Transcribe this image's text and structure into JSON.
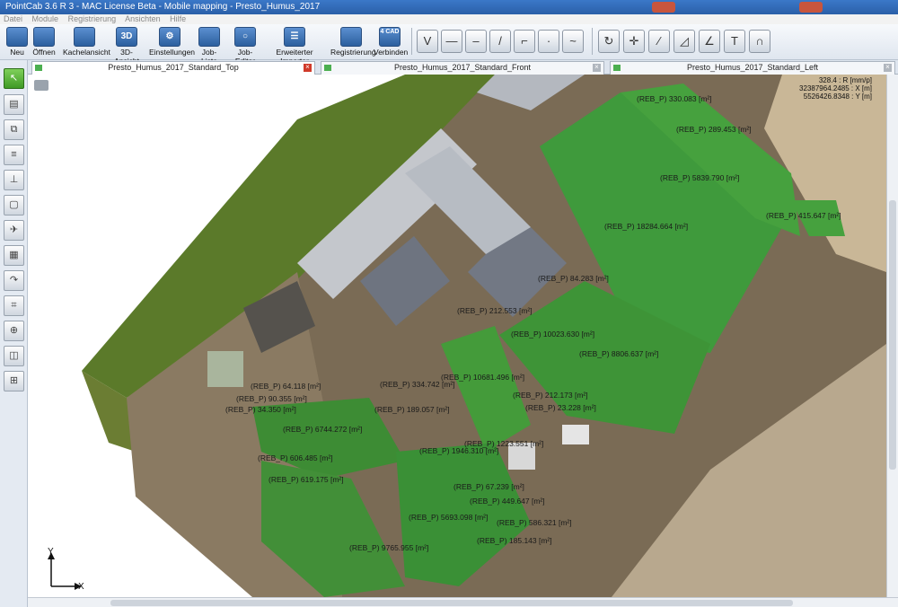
{
  "window": {
    "title": "PointCab 3.6 R 3 - MAC License Beta - Mobile mapping - Presto_Humus_2017"
  },
  "menu": [
    "Datei",
    "Module",
    "Registrierung",
    "Ansichten",
    "Hilfe"
  ],
  "toolbar": {
    "buttons": [
      {
        "label": "Neu",
        "icon": "new-icon"
      },
      {
        "label": "Öffnen",
        "icon": "open-folder-icon"
      },
      {
        "label": "Kachelansicht",
        "icon": "tile-view-icon"
      },
      {
        "label": "3D-Ansicht",
        "icon": "3d-view-icon",
        "glyph": "3D"
      },
      {
        "label": "Einstellungen",
        "icon": "settings-gear-icon"
      },
      {
        "label": "Job-Liste",
        "icon": "job-list-icon"
      },
      {
        "label": "Job-Editor",
        "icon": "job-editor-icon"
      },
      {
        "label": "Erweiterter Importer",
        "icon": "importer-icon"
      },
      {
        "label": "Registrierung",
        "icon": "registration-icon"
      },
      {
        "label": "Verbinden",
        "icon": "connect-cad-icon",
        "glyph": "4 CAD"
      }
    ]
  },
  "tabs": [
    {
      "label": "Presto_Humus_2017_Standard_Top",
      "active": true
    },
    {
      "label": "Presto_Humus_2017_Standard_Front",
      "active": false
    },
    {
      "label": "Presto_Humus_2017_Standard_Left",
      "active": false
    }
  ],
  "coords": {
    "resolution": "328.4 : R [mm/p]",
    "x": "32387964.2485 : X [m]",
    "y": "5526426.8348 : Y [m]"
  },
  "axes": {
    "y": "Y",
    "x": "X"
  },
  "areas": [
    "(REB_P) 330.083 [m²]",
    "(REB_P) 289.453 [m²]",
    "(REB_P) 5839.790 [m²]",
    "(REB_P) 415.647 [m²]",
    "(REB_P) 18284.664 [m²]",
    "(REB_P) 84.283 [m²]",
    "(REB_P) 212.553 [m²]",
    "(REB_P) 10023.630 [m²]",
    "(REB_P) 8806.637 [m²]",
    "(REB_P) 10681.496 [m²]",
    "(REB_P) 334.742 [m²]",
    "(REB_P) 64.118 [m²]",
    "(REB_P) 90.355 [m²]",
    "(REB_P) 34.350 [m²]",
    "(REB_P) 189.057 [m²]",
    "(REB_P) 212.173 [m²]",
    "(REB_P) 23.228 [m²]",
    "(REB_P) 6744.272 [m²]",
    "(REB_P) 1223.551 [m²]",
    "(REB_P) 1946.310 [m²]",
    "(REB_P) 606.485 [m²]",
    "(REB_P) 619.175 [m²]",
    "(REB_P) 67.239 [m²]",
    "(REB_P) 449.647 [m²]",
    "(REB_P) 5693.098 [m²]",
    "(REB_P) 586.321 [m²]",
    "(REB_P) 185.143 [m²]",
    "(REB_P) 9765.955 [m²]"
  ]
}
